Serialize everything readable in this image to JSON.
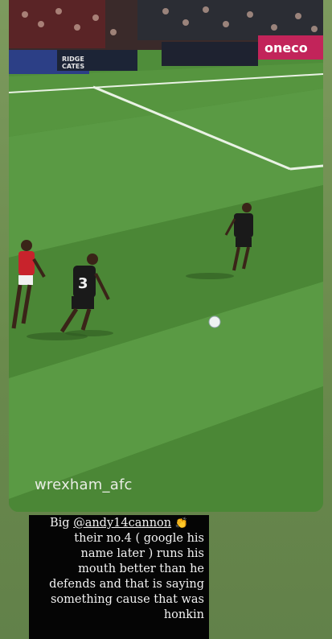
{
  "story": {
    "media": {
      "subject": "football-match-clip",
      "watermark": "wrexham_afc",
      "hoardings": [
        "oneco",
        "RIDGE",
        "CATES"
      ],
      "player_shirt_number": "3"
    },
    "caption": {
      "lines": [
        {
          "prefix": "Big ",
          "mention": "@andy14cannon",
          "suffix": ""
        },
        {
          "text": "their no.4 ( google his"
        },
        {
          "text": "name later ) runs his"
        },
        {
          "text": "mouth better than he"
        },
        {
          "text": "defends and that is saying"
        },
        {
          "text": "something cause that was"
        },
        {
          "text": "honkin"
        }
      ],
      "emoji_icon": "clapping-hands-icon"
    }
  },
  "colors": {
    "pitch_light": "#5d9a43",
    "pitch_dark": "#4a8535",
    "caption_bg": "#050505",
    "caption_text": "#f3f3f3",
    "home_kit": "#c8232c",
    "away_kit": "#1a1a1a"
  }
}
